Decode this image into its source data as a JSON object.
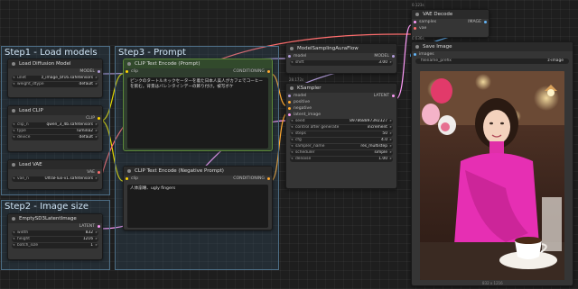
{
  "groups": {
    "load_models": "Step1 - Load models",
    "image_size": "Step2 - Image size",
    "prompt": "Step3 - Prompt"
  },
  "nodes": {
    "load_diffusion": {
      "title": "Load Diffusion Model",
      "output": "MODEL",
      "unet_name": "unet",
      "unet_value": "z_image_bf16.safetensors",
      "weight_dtype": "weight_dtype",
      "weight_value": "default"
    },
    "load_clip": {
      "title": "Load CLIP",
      "output": "CLIP",
      "clip_name": "clip_n",
      "clip_value": "qwen_3_4b.safetensors",
      "type": "type",
      "type_value": "lumina2",
      "device": "device",
      "device_value": "default"
    },
    "load_vae": {
      "title": "Load VAE",
      "output": "VAE",
      "vae_name": "vae_n",
      "vae_value": "UltraFlux-v1.safetensors"
    },
    "empty_latent": {
      "title": "EmptySD3LatentImage",
      "output": "LATENT",
      "width": "width",
      "width_value": "832",
      "height": "height",
      "height_value": "1216",
      "batch": "batch_size",
      "batch_value": "1"
    },
    "clip_pos": {
      "title": "CLIP Text Encode (Prompt)",
      "input": "clip",
      "output": "CONDITIONING",
      "text": "ピンクのタートルネックセーターを着た日本人美人がカフェでコーヒーを飲む。背景はバレンタインデーの飾り付け。被写ボケ"
    },
    "clip_neg": {
      "title": "CLIP Text Encode (Negative Prompt)",
      "input": "clip",
      "output": "CONDITIONING",
      "text": "人体崩壊、ugly fingers"
    },
    "model_sampling": {
      "title": "ModelSamplingAuraFlow",
      "input": "model",
      "output": "MODEL",
      "shift": "shift",
      "shift_value": "3.00"
    },
    "ksampler": {
      "title": "KSampler",
      "time": "28.172s",
      "inputs": [
        "model",
        "positive",
        "negative",
        "latent_image"
      ],
      "output": "LATENT",
      "seed": "seed",
      "seed_value": "897868897392327",
      "control": "control after generate",
      "control_value": "increment",
      "steps": "steps",
      "steps_value": "50",
      "cfg": "cfg",
      "cfg_value": "4.0",
      "sampler": "sampler_name",
      "sampler_value": "res_multistep",
      "scheduler": "scheduler",
      "scheduler_value": "simple",
      "denoise": "denoise",
      "denoise_value": "1.00"
    },
    "vae_decode": {
      "title": "VAE Decode",
      "time_top": "0.123s",
      "time_bottom": "0.636s",
      "inputs": [
        "samples",
        "vae"
      ],
      "output": "IMAGE"
    },
    "save_image": {
      "title": "Save Image",
      "input": "images",
      "prefix": "filename_prefix",
      "prefix_value": "z-image",
      "size": "832 x 1216"
    }
  },
  "colors": {
    "model": "#b39ddb",
    "clip": "#ffd500",
    "vae": "#ff6e6e",
    "latent": "#ff9cf9",
    "conditioning": "#ffa931",
    "image": "#64b5f6"
  }
}
